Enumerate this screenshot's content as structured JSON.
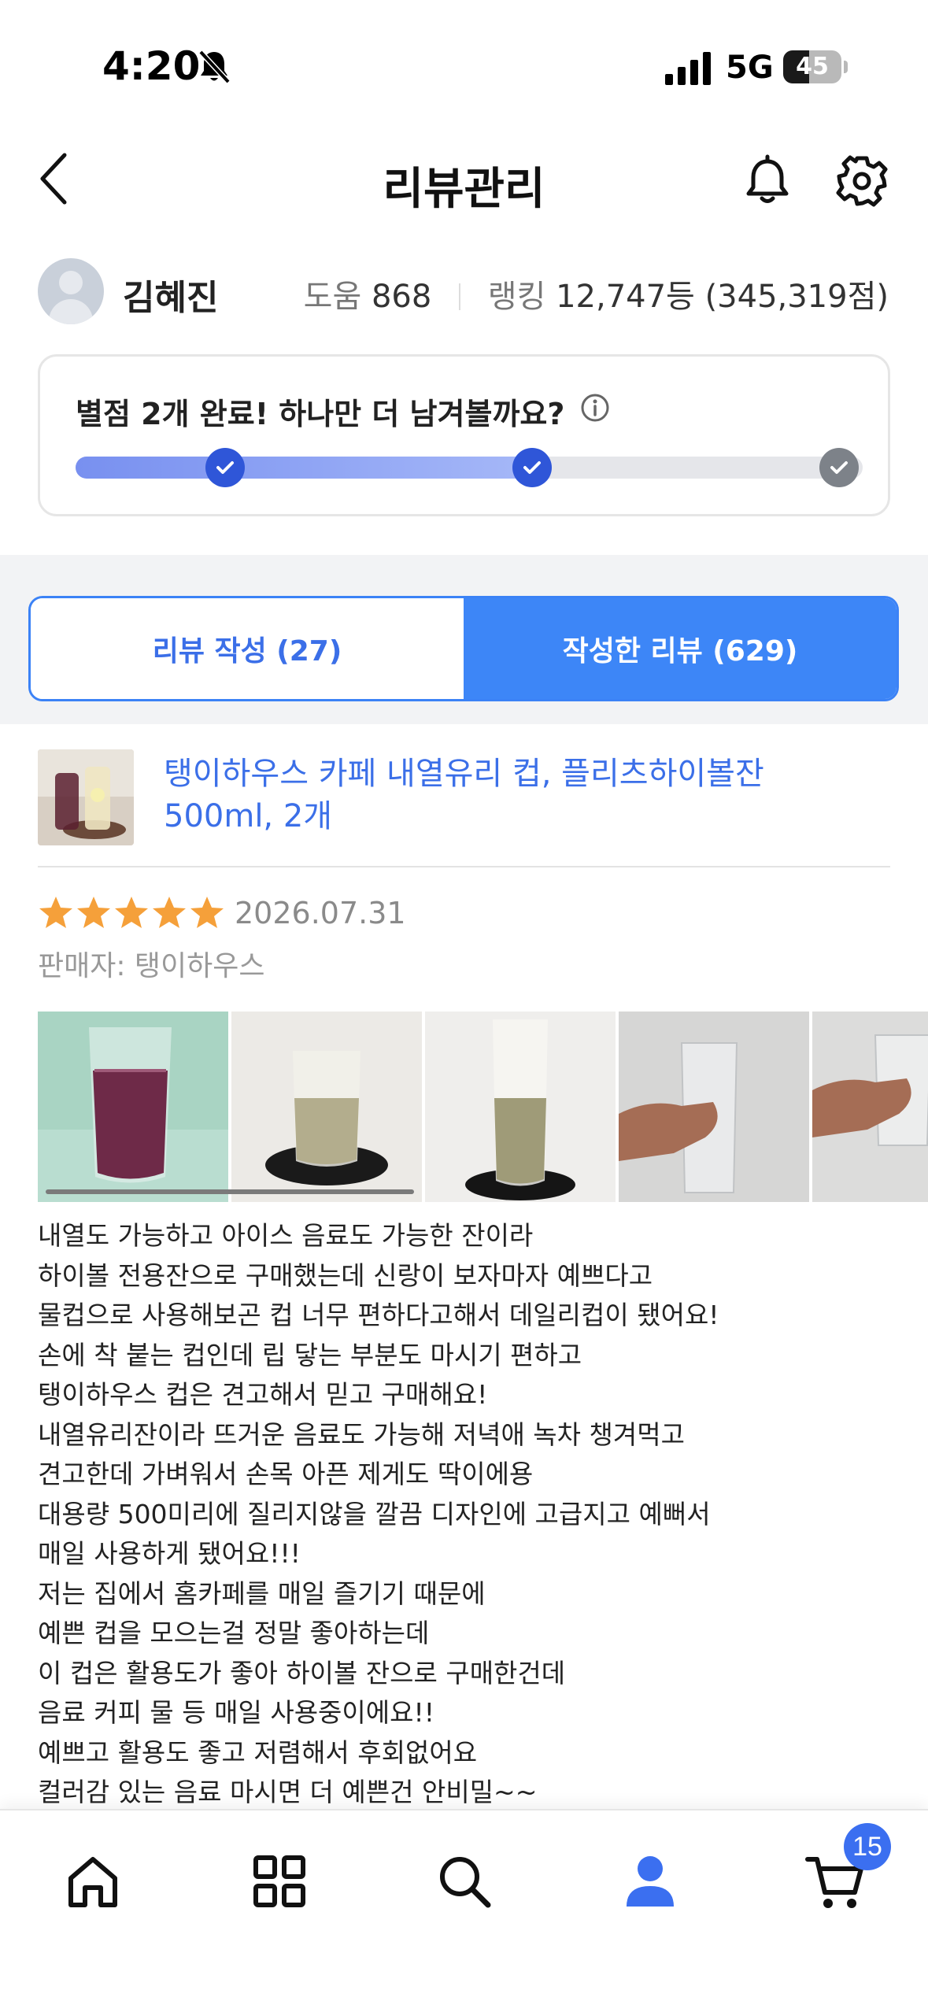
{
  "status_bar": {
    "time": "4:20",
    "network": "5G",
    "battery": "45",
    "battery_level": 0.45
  },
  "header": {
    "title": "리뷰관리"
  },
  "profile": {
    "name": "김혜진",
    "help_label": "도움",
    "help_value": "868",
    "rank_label": "랭킹",
    "rank_value": "12,747등 (345,319점)"
  },
  "progress": {
    "message": "별점 2개 완료! 하나만 더 남겨볼까요?",
    "completed_steps": 2,
    "total_steps": 3
  },
  "tabs": [
    {
      "label": "리뷰 작성 (27)",
      "active": false
    },
    {
      "label": "작성한 리뷰 (629)",
      "active": true
    }
  ],
  "product": {
    "name": "탱이하우스 카페 내열유리 컵, 플리츠하이볼잔 500ml, 2개"
  },
  "review": {
    "rating": 5,
    "date": "2026.07.31",
    "seller": "판매자: 탱이하우스",
    "lines": [
      "내열도 가능하고 아이스 음료도 가능한 잔이라",
      "하이볼 전용잔으로 구매했는데 신랑이 보자마자 예쁘다고",
      "물컵으로 사용해보곤 컵 너무 편하다고해서 데일리컵이 됐어요!",
      "손에 착 붙는 컵인데 립 닿는 부분도 마시기 편하고",
      "탱이하우스 컵은 견고해서 믿고 구매해요!",
      "내열유리잔이라 뜨거운 음료도 가능해 저녁애 녹차 챙겨먹고",
      "견고한데 가벼워서 손목 아픈 제게도 딱이에용",
      "대용량 500미리에 질리지않을 깔끔 디자인에 고급지고 예뻐서",
      "매일 사용하게 됐어요!!!",
      "저는 집에서 홈카페를 매일 즐기기 때문에",
      "예쁜 컵을 모으는걸 정말 좋아하는데",
      "이 컵은 활용도가 좋아 하이볼 잔으로 구매한건데",
      "음료 커피 물 등 매일 사용중이에요!!",
      "예쁘고 활용도 좋고 저렴해서 후회없어요",
      "컬러감 있는 음료 마시면 더 예쁜건 안비밀~~"
    ]
  },
  "bottom_nav": {
    "items": [
      "home-icon",
      "category-grid-icon",
      "search-icon",
      "profile-icon",
      "cart-icon"
    ],
    "active": "profile-icon",
    "cart_count": "15"
  },
  "colors": {
    "accent": "#3d86f7",
    "link": "#3b6fe8",
    "star": "#f5a03a",
    "check_done": "#2f56d8",
    "check_todo": "#7d8289"
  }
}
